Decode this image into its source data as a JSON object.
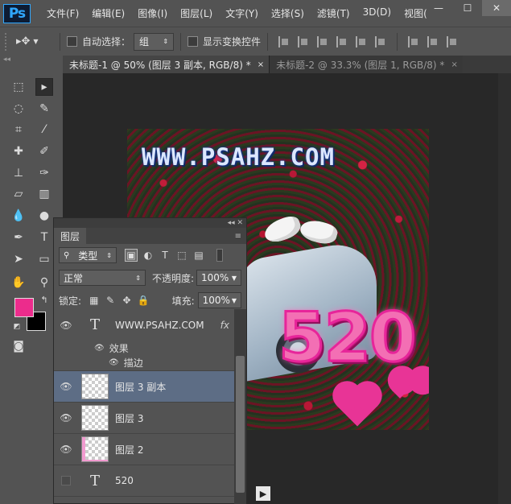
{
  "menu": {
    "logo": "Ps",
    "items": [
      "文件(F)",
      "编辑(E)",
      "图像(I)",
      "图层(L)",
      "文字(Y)",
      "选择(S)",
      "滤镜(T)",
      "3D(D)",
      "视图("
    ],
    "window_controls": [
      "—",
      "☐",
      "✕"
    ]
  },
  "options": {
    "auto_select_label": "自动选择：",
    "auto_select_value": "组",
    "show_transform_label": "显示变换控件"
  },
  "tabs": [
    {
      "label": "未标题-1 @ 50% (图层 3 副本, RGB/8) *",
      "close": "×"
    },
    {
      "label": "未标题-2 @ 33.3% (图层 1, RGB/8) *",
      "close": "×"
    }
  ],
  "toolbox": {
    "top_marker": "◂◂",
    "fg_color": "#ec2c8c",
    "bg_color": "#000000"
  },
  "canvas": {
    "url_text": "WWW.PSAHZ.COM",
    "number_text": "520"
  },
  "layers_panel": {
    "title": "图层",
    "top_controls": "◂◂ ✕",
    "menu_icon": "≡",
    "filter_kind": "类型",
    "blend_mode": "正常",
    "opacity_label": "不透明度:",
    "opacity_value": "100%",
    "lock_label": "锁定:",
    "fill_label": "填充:",
    "fill_value": "100%",
    "layers": [
      {
        "name": "WWW.PSAHZ.COM",
        "kind": "text",
        "fx": "fx",
        "visible": true
      },
      {
        "name": "图层 3 副本",
        "kind": "pixel",
        "visible": true,
        "selected": true
      },
      {
        "name": "图层 3",
        "kind": "pixel",
        "visible": true
      },
      {
        "name": "图层 2",
        "kind": "pixel",
        "visible": true
      },
      {
        "name": "520",
        "kind": "text",
        "visible": false
      }
    ],
    "effects_label": "效果",
    "stroke_label": "描边"
  }
}
